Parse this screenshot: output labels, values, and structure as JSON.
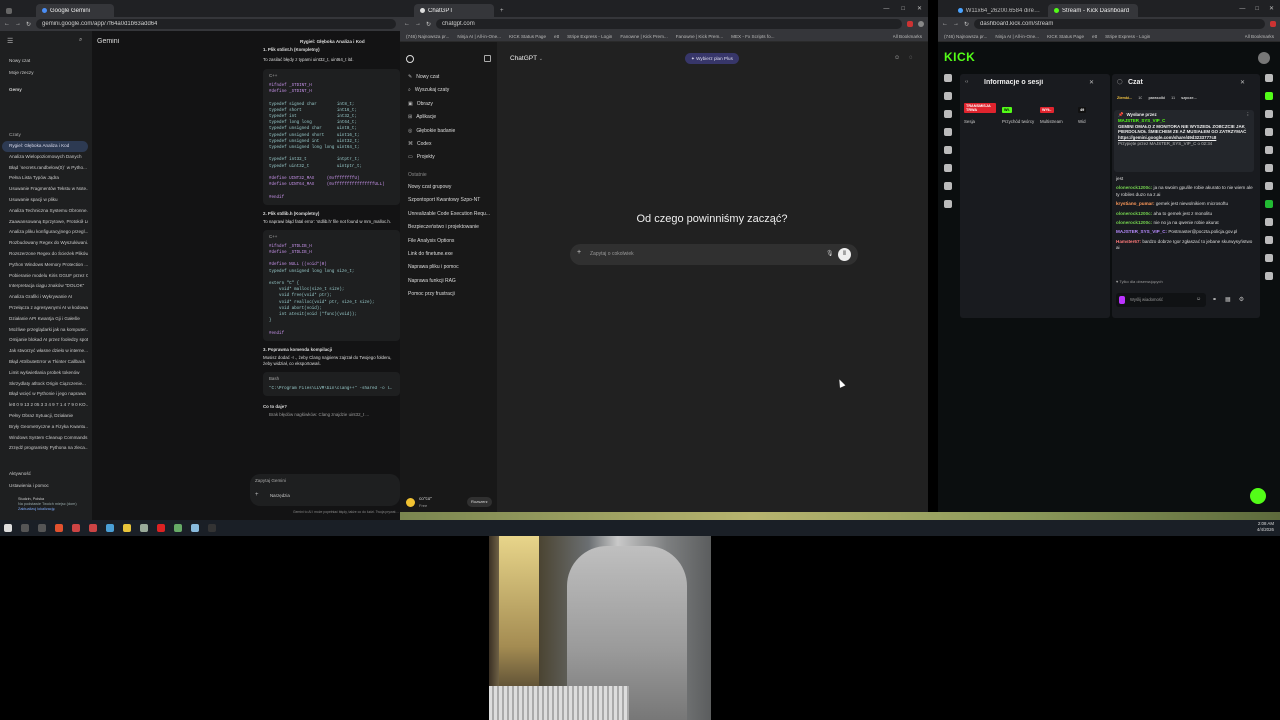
{
  "gemini": {
    "tab_title": "Google Gemini",
    "url": "gemini.google.com/app/7f64a0d1b63add64",
    "brand": "Gemini",
    "conversation_title": "Rygiel: Głęboka Analiza i Kod",
    "new_chat": "Nowy czat",
    "my_items": "Moje rzeczy",
    "gems": "Gemy",
    "chats_header": "Czaty",
    "chats": [
      "Rygiel: Głęboka Analiza i Kod",
      "Analiza Wielopoziomowych Danych",
      "Błąd `secrets.randbelow(0)` w Pytho...",
      "Pełna Lista Typów Jądra",
      "Usuwanie Fragmentów Tekstu w Note...",
      "Usuwanie spacji w pliku",
      "Analiza Techniczna Systemu Obronne...",
      "Zaawansowaną Eprzytowe, Protokół Lu...",
      "Analiza pliku konfiguracyjnego przegl...",
      "Rozbudowany Regex do Wyszukiwani...",
      "Rozszerzone Regex do Ścieżek Plików",
      "Python Windows Memory Protection ...",
      "Pobieranie modelu Kiris GGUF przez C...",
      "Interpretacja ciągu znaków \"DOLOK\"",
      "Analiza Grafiki i Wykrywanie AI",
      "Przełącza z agresywnymi AI w kodowaniu",
      "Działanie API Kwantja Gji i Gałeśle",
      "Możliwe przeglądarki jak na komputer...",
      "Omijanie blokad AI przez fooledzy spot...",
      "Jak stworzyć własne dzieło w interne...",
      "Błąd AttributeError w Tkinter Callback",
      "Limit wyświetlania probek tokenów",
      "Skrzydlaty atltock Origin Ciązczenie...",
      "Błąd wcięć w Pythonie i jego naprawa",
      "lett 0 9 13 2 05 3 3 4 9 7 1 4 7 9 0 KO...",
      "Pełny Obraz Sytuacji, Działanie",
      "Bryły Geometryczne a Fizyka Kwantu...",
      "Windows System Cleanup Commands",
      "Zrzędź programisty Pythona na zleca..."
    ],
    "activity": "Aktywność",
    "settings": "Ustawienia i pomoc",
    "location": "Studzin, Polska",
    "location_sub": "Na podstawie Twoich miejsc (dom)",
    "location_link": "Zaktualizuj lokalizację",
    "intro_line": "To zasilać błędy z typami uint32_t, uint64_t itd.",
    "section1_header": "1. Plik stdint.h (Kompletny)",
    "code1": [
      "#ifndef _STDINT_H",
      "#define _STDINT_H",
      "",
      "typedef signed char        int8_t;",
      "typedef short              int16_t;",
      "typedef int                int32_t;",
      "typedef long long          int64_t;",
      "typedef unsigned char      uint8_t;",
      "typedef unsigned short     uint16_t;",
      "typedef unsigned int       uint32_t;",
      "typedef unsigned long long uint64_t;",
      "",
      "typedef int32_t            intptr_t;",
      "typedef uint32_t           uintptr_t;",
      "",
      "#define UINT32_MAX     (0xffffffffU)",
      "#define UINT64_MAX     (0xffffffffffffffffULL)",
      "",
      "#endif"
    ],
    "section2_header": "2. Plik stdlib.h (Kompletny)",
    "section2_text": "To naprawi błąd fatal error: 'stdlib.h' file not found w mm_malloc.h.",
    "code2": [
      "#ifndef _STDLIB_H",
      "#define _STDLIB_H",
      "",
      "#define NULL ((void*)0)",
      "typedef unsigned long long size_t;",
      "",
      "extern \"C\" {",
      "    void* malloc(size_t size);",
      "    void free(void* ptr);",
      "    void* realloc(void* ptr, size_t size);",
      "    void abort(void);",
      "    int atexit(void (*func)(void));",
      "}",
      "",
      "#endif"
    ],
    "section3_header": "3. Poprawna komenda kompilacji",
    "section3_text": "Musisz dodać -I ., żeby Clang najpierw zajrzał do Twojego folderu, żeby widział, co eksportowaś.",
    "bash_label": "Bash",
    "bash_cmd": "\"C:\\Program Files\\LLVM\\bin\\clang++\" -shared -o loglog...",
    "what_header": "Co to daje?",
    "what_bullet": "Brak błędów nagłówków: Clang znajdzie uint32_t ...",
    "ask_placeholder": "Zapytaj Gemini",
    "tools": "Narzędzia",
    "disclaimer": "Gemini to AI i może popełniać błędy, także co do ludzi. Twoja prywatność"
  },
  "chatgpt": {
    "tab_title": "ChatGPT",
    "url": "chatgpt.com",
    "bookmarks": [
      "(746) Najnowsza pr...",
      "Ninja AI | All-in-One...",
      "KICK Status Page",
      "ett",
      "Stripe Express - Login",
      "Fanowne | Kick Prem...",
      "Fanowne | Kick Prem...",
      "MEX - Fx Scripts fo..."
    ],
    "all_bookmarks": "All Bookmarks",
    "model": "ChatGPT",
    "upgrade": "Wybierz plan Plus",
    "sidebar_items": [
      "Nowy czat",
      "Wyszukaj czaty",
      "Obrazy",
      "Aplikacje",
      "Głębokie badanie",
      "Codex",
      "Projekty"
    ],
    "recent_header": "Ostatnie",
    "recent": [
      "Nowy czat grupowy",
      "Szpontoport Kwantowy Szpo-NT",
      "Unrealizable Code Execution Requ...",
      "Bezpieczeństwo i projektowanie",
      "File Analysis Options",
      "Link do finetune.exe",
      "Naprawa pliku i pomoc",
      "Naprawa funkcji RAG",
      "Pomoc przy frustracji"
    ],
    "headline": "Od czego powinniśmy zacząć?",
    "placeholder": "Zapytaj o cokolwiek",
    "user_name": "co\"co\"",
    "user_plan": "Free",
    "upgrade_btn": "Rozszerz"
  },
  "kick": {
    "tabs": [
      "W11x64_26200.6584 directory",
      "Stream - Kick Dashboard"
    ],
    "url": "dashboard.kick.com/stream",
    "bookmarks": [
      "(746) Najnowsza pr...",
      "Ninja AI | All-in-One...",
      "KICK Status Page",
      "ett",
      "Stripe Express - Login"
    ],
    "all_bookmarks": "All Bookmarks",
    "logo": "KICK",
    "session_title": "Informacje o sesji",
    "session_badges": [
      {
        "label": "TRANSMISJA TRWA",
        "sub": "Sesja",
        "color": "#e0242e"
      },
      {
        "label": "Wł.",
        "sub": "Przychód twórcy",
        "color": "#53fc18"
      },
      {
        "label": "WYŁ.",
        "sub": "Multistream",
        "color": "#e0242e"
      },
      {
        "label": "49",
        "sub": "Wid",
        "color": "#111111"
      }
    ],
    "chat_title": "Czat",
    "chat_tabs": [
      "Ziemki...",
      "10",
      "parasolki",
      "11",
      "szpcze..."
    ],
    "pinned_label": "Wysłane przez",
    "pinned_user": "MAJSTER_SYS_VIP_C",
    "pinned_text": "GEMINI OMAŁO Z MONITORA NIE WYSZEDŁ ZOBCZCIE JAK PIERDOLNOŁ ŚMIECHEM ZE AŻ MUSIAŁEM GO ZATRZYMAĆ",
    "pinned_link": "https://gemini.google.com/share/49d3233777c8",
    "pinned_by": "Przypięte przez MAJSTER_SYS_VIP_C o 02:34",
    "messages": [
      {
        "user": "",
        "text": "jest"
      },
      {
        "user": "olonerock1200c:",
        "text": "ja na swoim gpu/ile robie akurato to nie wiem ale ty robiles duzo na z.ai"
      },
      {
        "user": "krystiano_pumar:",
        "text": "gemek jest niewolnikiem microsoftu"
      },
      {
        "user": "olonerock1200c:",
        "text": "aha to gemek jest z monolitu"
      },
      {
        "user": "olonerock1200c:",
        "text": "nie no ja na qwenie robie akurat"
      },
      {
        "user": "MAJSTER_SYS_VIP_C:",
        "text": "Postmaster@poczta.policja.gov.pl"
      },
      {
        "user": "Hamster67:",
        "text": "bardzo dobrze Igor zgłaszać to jebane skurwysyństwo ai"
      }
    ],
    "only_followers": "Tylko dla obserwujących",
    "send_placeholder": "Wyślij wiadomość"
  },
  "taskbar": {
    "time": "2:08 AM",
    "date": "4/4/2026"
  }
}
